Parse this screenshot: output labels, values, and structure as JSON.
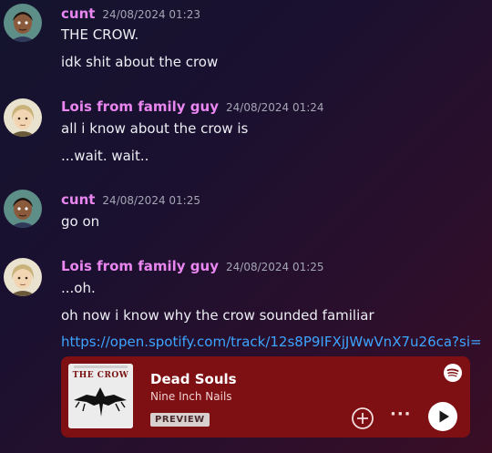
{
  "messages": [
    {
      "author": "cunt",
      "timestamp": "24/08/2024 01:23",
      "lines": [
        "THE CROW.",
        "idk shit about the crow"
      ]
    },
    {
      "author": "Lois from family guy",
      "timestamp": "24/08/2024 01:24",
      "lines": [
        "all i know about the crow is",
        "...wait. wait.."
      ]
    },
    {
      "author": "cunt",
      "timestamp": "24/08/2024 01:25",
      "lines": [
        "go on"
      ]
    },
    {
      "author": "Lois from family guy",
      "timestamp": "24/08/2024 01:25",
      "lines": [
        "...oh.",
        "oh now i know why the crow sounded familiar"
      ],
      "link": "https://open.spotify.com/track/12s8P9IFXjJWwVnX7u26ca?si="
    }
  ],
  "embed": {
    "song": "Dead Souls",
    "artist": "Nine Inch Nails",
    "preview_label": "PREVIEW",
    "more_label": "···",
    "cover_text": "THE CROW",
    "accent_color": "#7e0f12"
  },
  "colors": {
    "username": "#e986f0",
    "link": "#3da4ff"
  }
}
